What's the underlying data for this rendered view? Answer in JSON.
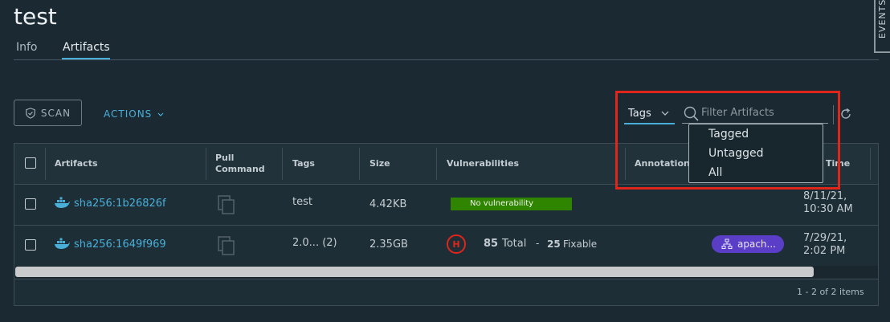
{
  "page": {
    "title": "test"
  },
  "tabs": [
    {
      "label": "Info"
    },
    {
      "label": "Artifacts",
      "active": true
    }
  ],
  "side_panel": {
    "label": "EVENTS"
  },
  "toolbar": {
    "scan_label": "SCAN",
    "actions_label": "ACTIONS",
    "filter_type": "Tags",
    "filter_placeholder": "Filter Artifacts",
    "filter_options": [
      "Tagged",
      "Untagged",
      "All"
    ]
  },
  "table": {
    "headers": {
      "artifacts": "Artifacts",
      "pull_line1": "Pull",
      "pull_line2": "Command",
      "tags": "Tags",
      "size": "Size",
      "vulnerabilities": "Vulnerabilities",
      "annotations": "Annotations",
      "time": "Time"
    },
    "rows": [
      {
        "artifact": "sha256:1b26826f",
        "tags": "test",
        "size": "4.42KB",
        "vuln_text": "No vulnerability",
        "time_line1": "8/11/21,",
        "time_line2": "10:30 AM"
      },
      {
        "artifact": "sha256:1649f969",
        "tags": "2.0... (2)",
        "size": "2.35GB",
        "severity": "H",
        "total_count": "85",
        "total_label": "Total",
        "sep": "-",
        "fixable_count": "25",
        "fixable_label": "Fixable",
        "label": "apach...",
        "time_line1": "7/29/21,",
        "time_line2": "2:02 PM"
      }
    ],
    "pagination": "1 - 2 of 2 items"
  },
  "colors": {
    "accent": "#49afd9",
    "danger": "#e0261b",
    "success": "#2f8400",
    "label": "#5a3ec8"
  }
}
